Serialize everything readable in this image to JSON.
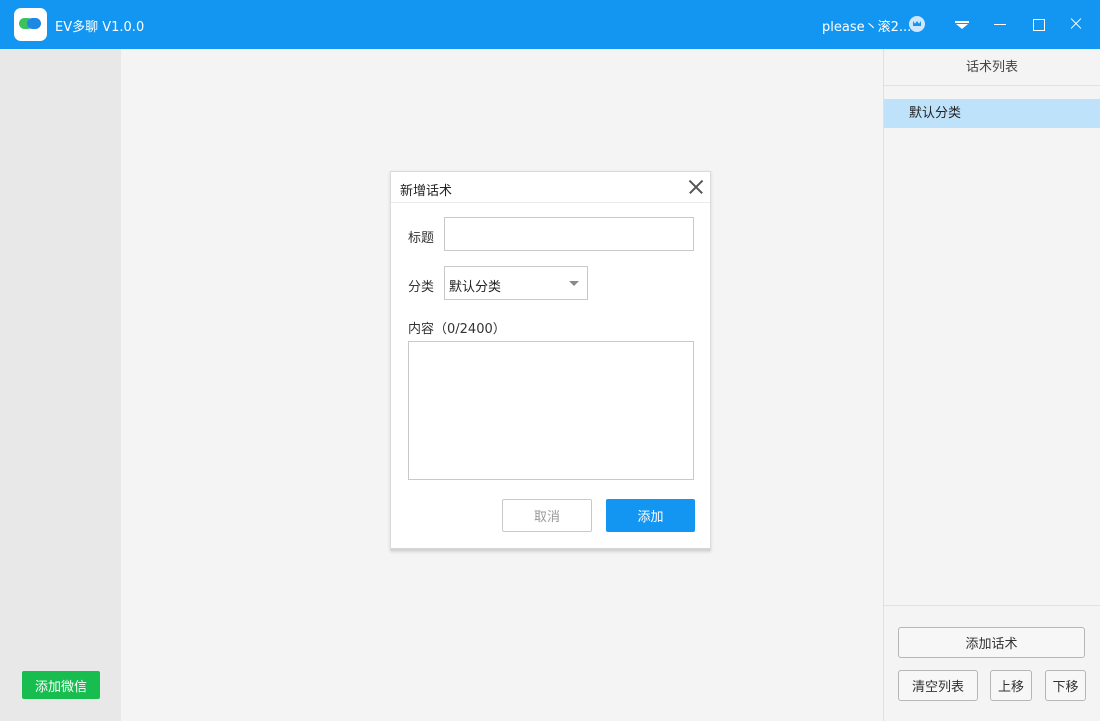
{
  "titlebar": {
    "app_title": "EV多聊  V1.0.0",
    "user_name": "please丶滚2...",
    "icons": [
      "app-logo",
      "crown-icon",
      "menu-icon",
      "minimize-icon",
      "maximize-icon",
      "close-icon"
    ]
  },
  "left_sidebar": {
    "add_wechat_label": "添加微信"
  },
  "right_panel": {
    "title": "话术列表",
    "categories": [
      "默认分类"
    ],
    "add_script_label": "添加话术",
    "clear_list_label": "清空列表",
    "move_up_label": "上移",
    "move_down_label": "下移"
  },
  "dialog": {
    "title": "新增话术",
    "title_label": "标题",
    "title_value": "",
    "category_label": "分类",
    "category_value": "默认分类",
    "content_label": "内容（0/2400）",
    "content_value": "",
    "cancel_label": "取消",
    "add_label": "添加"
  },
  "colors": {
    "titlebar": "#1296f2",
    "primary_button": "#1296f2",
    "wechat_button": "#18bd50",
    "selected_category": "#bfe2fb"
  }
}
